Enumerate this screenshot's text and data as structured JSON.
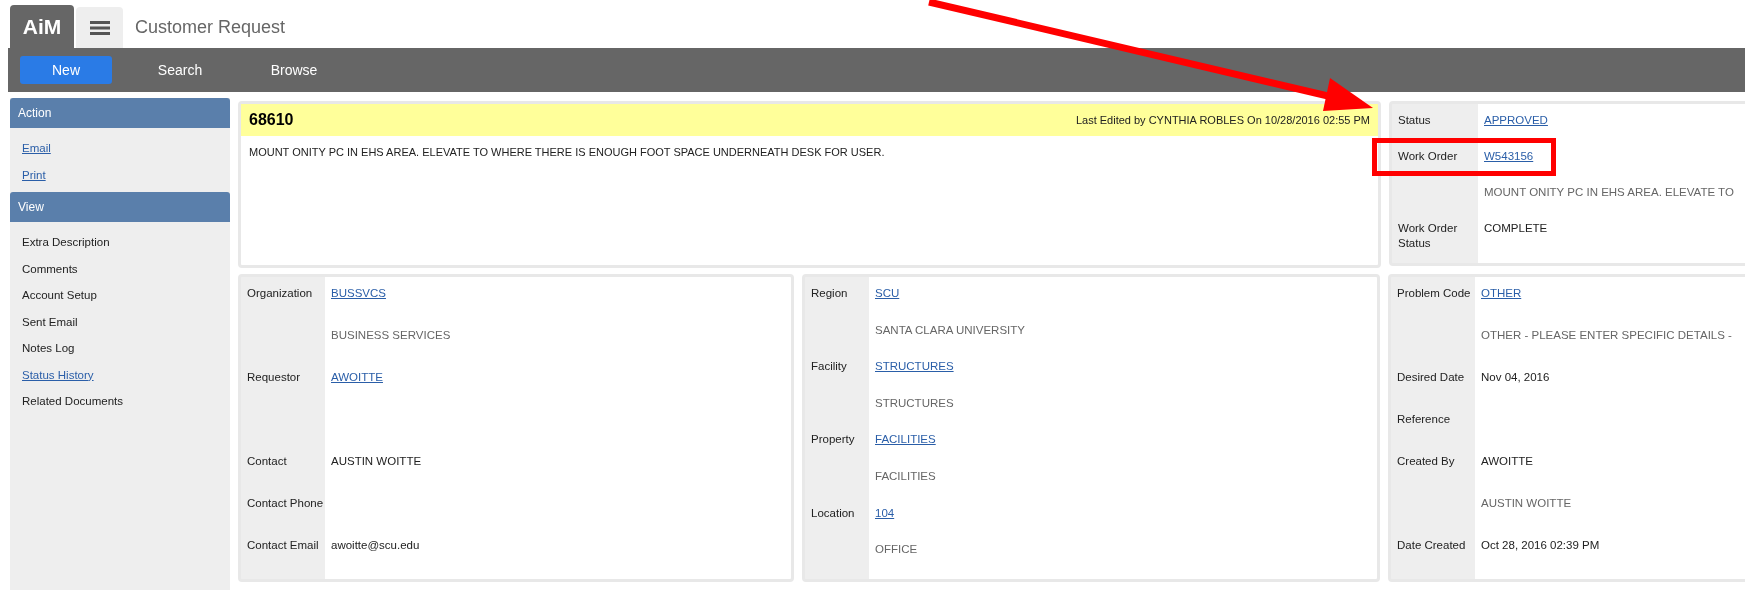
{
  "header": {
    "logo": "AiM",
    "title": "Customer Request"
  },
  "nav": [
    {
      "label": "New",
      "kind": "primary"
    },
    {
      "label": "Search",
      "kind": "plain"
    },
    {
      "label": "Browse",
      "kind": "plain"
    }
  ],
  "sidebar": [
    {
      "title": "Action",
      "items": [
        {
          "label": "Email",
          "link": true
        },
        {
          "label": "Print",
          "link": true
        }
      ]
    },
    {
      "title": "View",
      "items": [
        {
          "label": "Extra Description",
          "link": false
        },
        {
          "label": "Comments",
          "link": false
        },
        {
          "label": "Account Setup",
          "link": false
        },
        {
          "label": "Sent Email",
          "link": false
        },
        {
          "label": "Notes Log",
          "link": false
        },
        {
          "label": "Status History",
          "link": true
        },
        {
          "label": "Related Documents",
          "link": false
        }
      ]
    }
  ],
  "record": {
    "number": "68610",
    "last_edited": "Last Edited by CYNTHIA ROBLES On 10/28/2016 02:55 PM",
    "description": "MOUNT ONITY PC IN EHS AREA. ELEVATE TO WHERE THERE IS ENOUGH FOOT SPACE UNDERNEATH DESK FOR USER."
  },
  "status_panel": [
    {
      "label": "Status",
      "value": "APPROVED",
      "kind": "link",
      "highlighted": false
    },
    {
      "label": "Work Order",
      "value": "W543156",
      "kind": "link",
      "highlighted": true
    },
    {
      "value": "MOUNT ONITY PC IN EHS AREA. ELEVATE TO",
      "kind": "sub",
      "highlighted": false
    },
    {
      "label": "Work Order Status",
      "value": "COMPLETE",
      "kind": "text",
      "highlighted": false
    }
  ],
  "panels": [
    [
      {
        "label": "Organization",
        "value": "BUSSVCS",
        "kind": "link"
      },
      {
        "value": "BUSINESS SERVICES",
        "kind": "sub"
      },
      {
        "label": "Requestor",
        "value": "AWOITTE",
        "kind": "link"
      },
      {
        "kind": "gap"
      },
      {
        "label": "Contact",
        "value": "AUSTIN WOITTE",
        "kind": "text"
      },
      {
        "label": "Contact Phone",
        "kind": "text"
      },
      {
        "label": "Contact Email",
        "value": "awoitte@scu.edu",
        "kind": "text"
      }
    ],
    [
      {
        "label": "Region",
        "value": "SCU",
        "kind": "link"
      },
      {
        "value": "SANTA CLARA UNIVERSITY",
        "kind": "sub"
      },
      {
        "label": "Facility",
        "value": "STRUCTURES",
        "kind": "link"
      },
      {
        "value": "STRUCTURES",
        "kind": "sub"
      },
      {
        "label": "Property",
        "value": "FACILITIES",
        "kind": "link"
      },
      {
        "value": "FACILITIES",
        "kind": "sub"
      },
      {
        "label": "Location",
        "value": "104",
        "kind": "link"
      },
      {
        "value": "OFFICE",
        "kind": "sub"
      }
    ],
    [
      {
        "label": "Problem Code",
        "value": "OTHER",
        "kind": "link"
      },
      {
        "value": "OTHER - PLEASE ENTER SPECIFIC DETAILS -",
        "kind": "sub"
      },
      {
        "label": "Desired Date",
        "value": "Nov 04, 2016",
        "kind": "text"
      },
      {
        "label": "Reference",
        "kind": "text"
      },
      {
        "label": "Created By",
        "value": "AWOITTE",
        "kind": "text"
      },
      {
        "value": "AUSTIN WOITTE",
        "kind": "sub"
      },
      {
        "label": "Date Created",
        "value": "Oct 28, 2016 02:39 PM",
        "kind": "text"
      }
    ]
  ]
}
